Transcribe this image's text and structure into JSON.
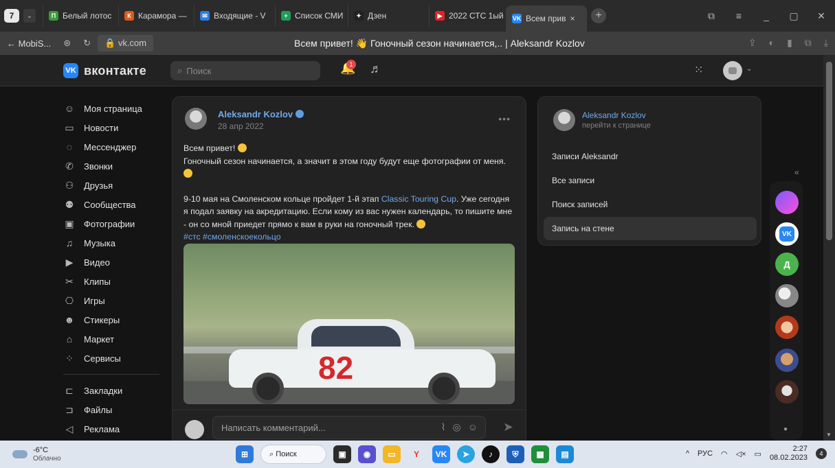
{
  "browser": {
    "tab_count": "7",
    "tabs": [
      {
        "label": "Белый лотос",
        "color": "#3a9b3a",
        "icon": "П"
      },
      {
        "label": "Карамора —",
        "color": "#d85b1d",
        "icon": "К"
      },
      {
        "label": "Входящие - V",
        "color": "#2d7be6",
        "icon": "✉"
      },
      {
        "label": "Список СМИ",
        "color": "#1e9e5a",
        "icon": "+"
      },
      {
        "label": "Дзен",
        "color": "#222222",
        "icon": "✦"
      },
      {
        "label": "2022 СТС 1ый",
        "color": "#e02424",
        "icon": "▶"
      },
      {
        "label": "Всем прив",
        "color": "#2787f5",
        "icon": "VK"
      }
    ],
    "back_label": "← MobiS...",
    "url": "vk.com",
    "page_title": "Всем привет! 👋 Гоночный сезон начинается,.. | Aleksandr Kozlov"
  },
  "vk": {
    "logo_icon": "VK",
    "logo_text": "вконтакте",
    "search_placeholder": "Поиск",
    "notifications_count": "1",
    "nav": [
      {
        "icon": "☺",
        "label": "Моя страница"
      },
      {
        "icon": "▭",
        "label": "Новости"
      },
      {
        "icon": "◌",
        "label": "Мессенджер"
      },
      {
        "icon": "✆",
        "label": "Звонки"
      },
      {
        "icon": "⚇",
        "label": "Друзья"
      },
      {
        "icon": "⚉",
        "label": "Сообщества"
      },
      {
        "icon": "▣",
        "label": "Фотографии"
      },
      {
        "icon": "♫",
        "label": "Музыка"
      },
      {
        "icon": "▶",
        "label": "Видео"
      },
      {
        "icon": "✂",
        "label": "Клипы"
      },
      {
        "icon": "⎔",
        "label": "Игры"
      },
      {
        "icon": "☻",
        "label": "Стикеры"
      },
      {
        "icon": "⌂",
        "label": "Маркет"
      },
      {
        "icon": "⁘",
        "label": "Сервисы"
      }
    ],
    "nav_bottom": [
      {
        "icon": "⊏",
        "label": "Закладки"
      },
      {
        "icon": "⊐",
        "label": "Файлы"
      },
      {
        "icon": "◁",
        "label": "Реклама"
      }
    ]
  },
  "post": {
    "author": "Aleksandr Kozlov",
    "date": "28 апр 2022",
    "line1": "Всем привет!",
    "line2": "Гоночный сезон начинается, а значит в этом году будут еще фотографии от меня.",
    "line3a": "9-10 мая на Смоленском кольце пройдет 1-й этап ",
    "line3_link": "Classic Touring Cup",
    "line3b": ". Уже сегодня я подал заявку на акредитацию. Если кому из вас нужен календарь, то пишите мне - он со мной приедет прямо к вам в руки на гоночный трек.",
    "hashtags": "#стс #смоленскоекольцо",
    "car_number": "82",
    "comment_placeholder": "Написать комментарий..."
  },
  "right_card": {
    "name": "Aleksandr Kozlov",
    "subtitle": "перейти к странице",
    "items": [
      "Записи Aleksandr",
      "Все записи",
      "Поиск записей",
      "Запись на стене"
    ],
    "selected_index": 3
  },
  "float_bar": {
    "letter_avatar": "Д",
    "vk_icon": "VK"
  },
  "taskbar": {
    "temperature": "-6°C",
    "weather": "Облачно",
    "search_label": "Поиск",
    "lang": "РУС",
    "time": "2:27",
    "date": "08.02.2023",
    "notifications": "4"
  }
}
